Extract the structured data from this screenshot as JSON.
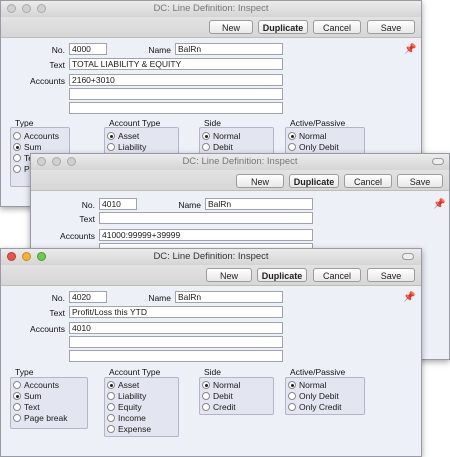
{
  "buttons": {
    "new": "New",
    "duplicate": "Duplicate",
    "cancel": "Cancel",
    "save": "Save"
  },
  "labels": {
    "no": "No.",
    "name": "Name",
    "text": "Text",
    "accounts": "Accounts"
  },
  "group_titles": {
    "type": "Type",
    "account_type": "Account Type",
    "side": "Side",
    "active_passive": "Active/Passive"
  },
  "win1": {
    "title": "DC: Line Definition: Inspect",
    "no": "4000",
    "name": "BalRn",
    "text": "TOTAL LIABILITY & EQUITY",
    "accounts": "2160+3010",
    "type_options": [
      "Accounts",
      "Sum",
      "Te",
      "Pa"
    ],
    "account_type_options": [
      "Asset",
      "Liability"
    ],
    "side_options": [
      "Normal",
      "Debit"
    ],
    "active_passive_options": [
      "Normal",
      "Only Debit"
    ]
  },
  "win2": {
    "title": "DC: Line Definition: Inspect",
    "no": "4010",
    "name": "BalRn",
    "text": "",
    "accounts": "41000:99999+39999"
  },
  "win3": {
    "title": "DC: Line Definition: Inspect",
    "no": "4020",
    "name": "BalRn",
    "text": "Profit/Loss this YTD",
    "accounts": "4010",
    "type_options": [
      "Accounts",
      "Sum",
      "Text",
      "Page break"
    ],
    "type_selected": 1,
    "account_type_options": [
      "Asset",
      "Liability",
      "Equity",
      "Income",
      "Expense"
    ],
    "account_type_selected": 0,
    "side_options": [
      "Normal",
      "Debit",
      "Credit"
    ],
    "side_selected": 0,
    "active_passive_options": [
      "Normal",
      "Only Debit",
      "Only Credit"
    ],
    "active_passive_selected": 0
  },
  "icons": {
    "pin": "pushpin-icon"
  }
}
